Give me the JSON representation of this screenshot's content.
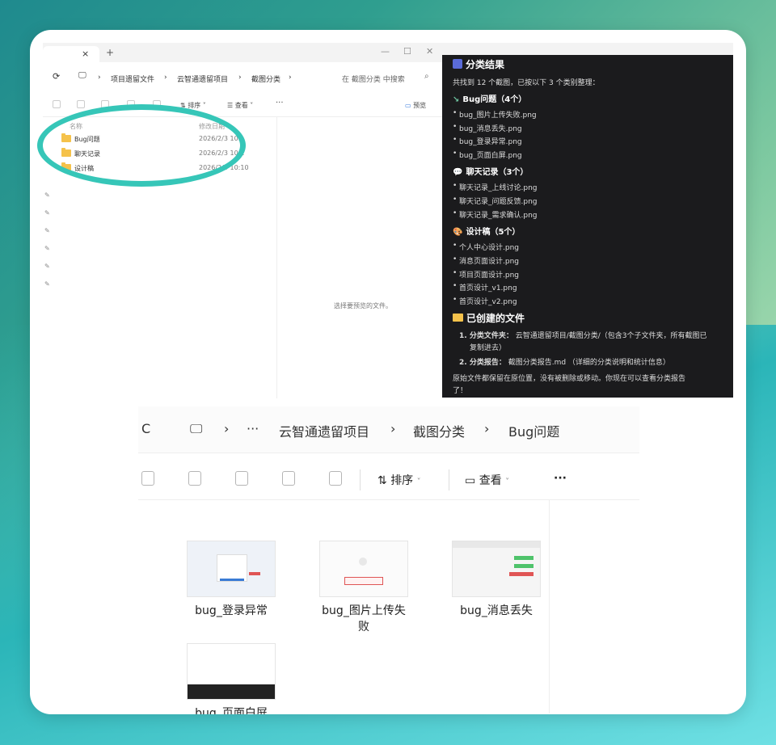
{
  "explorer": {
    "tab_close": "×",
    "new_tab": "+",
    "window_controls": [
      "—",
      "☐",
      "✕"
    ],
    "breadcrumb": [
      "项目遗留文件",
      "云智通遗留项目",
      "截图分类"
    ],
    "search_placeholder": "在 截图分类 中搜索",
    "toolbar": {
      "sort": "排序",
      "view": "查看",
      "more": "···",
      "preview": "预览"
    },
    "columns": {
      "name": "名称",
      "modified": "修改日期"
    },
    "rows": [
      {
        "name": "Bug问题",
        "date": "2026/2/3 10:"
      },
      {
        "name": "聊天记录",
        "date": "2026/2/3 10:1"
      },
      {
        "name": "设计稿",
        "date": "2026/2/3 10:10"
      }
    ],
    "preview_hint": "选择要预览的文件。"
  },
  "results": {
    "title": "分类结果",
    "summary": "共找到 12 个截图，已按以下 3 个类别整理：",
    "groups": [
      {
        "title": "Bug问题（4个）",
        "items": [
          "bug_图片上传失败.png",
          "bug_消息丢失.png",
          "bug_登录异常.png",
          "bug_页面白屏.png"
        ]
      },
      {
        "title": "聊天记录（3个）",
        "items": [
          "聊天记录_上线讨论.png",
          "聊天记录_问题反馈.png",
          "聊天记录_需求确认.png"
        ]
      },
      {
        "title": "设计稿（5个）",
        "items": [
          "个人中心设计.png",
          "消息页面设计.png",
          "项目页面设计.png",
          "首页设计_v1.png",
          "首页设计_v2.png"
        ]
      }
    ],
    "created_title": "已创建的文件",
    "created": [
      {
        "label": "1. 分类文件夹：",
        "text": "云智通遗留项目/截图分类/（包含3个子文件夹，所有截图已",
        "text2": "复制进去）"
      },
      {
        "label": "2. 分类报告：",
        "text": "截图分类报告.md （详细的分类说明和统计信息）"
      }
    ],
    "footer1": "原始文件都保留在原位置，没有被删除或移动。你现在可以查看分类报告",
    "footer2": "了！"
  },
  "bottom": {
    "refresh": "C",
    "ellipsis": "···",
    "breadcrumb": [
      "云智通遗留项目",
      "截图分类",
      "Bug问题"
    ],
    "sort": "排序",
    "view": "查看",
    "more": "···",
    "files": [
      {
        "name": "bug_登录异常"
      },
      {
        "name": "bug_图片上传失",
        "name2": "败"
      },
      {
        "name": "bug_消息丢失"
      },
      {
        "name": "bug_页面白屏"
      }
    ]
  },
  "colors": {
    "highlight": "#36c6b8",
    "dark_panel": "#1b1b1d",
    "folder": "#f5c24b"
  }
}
